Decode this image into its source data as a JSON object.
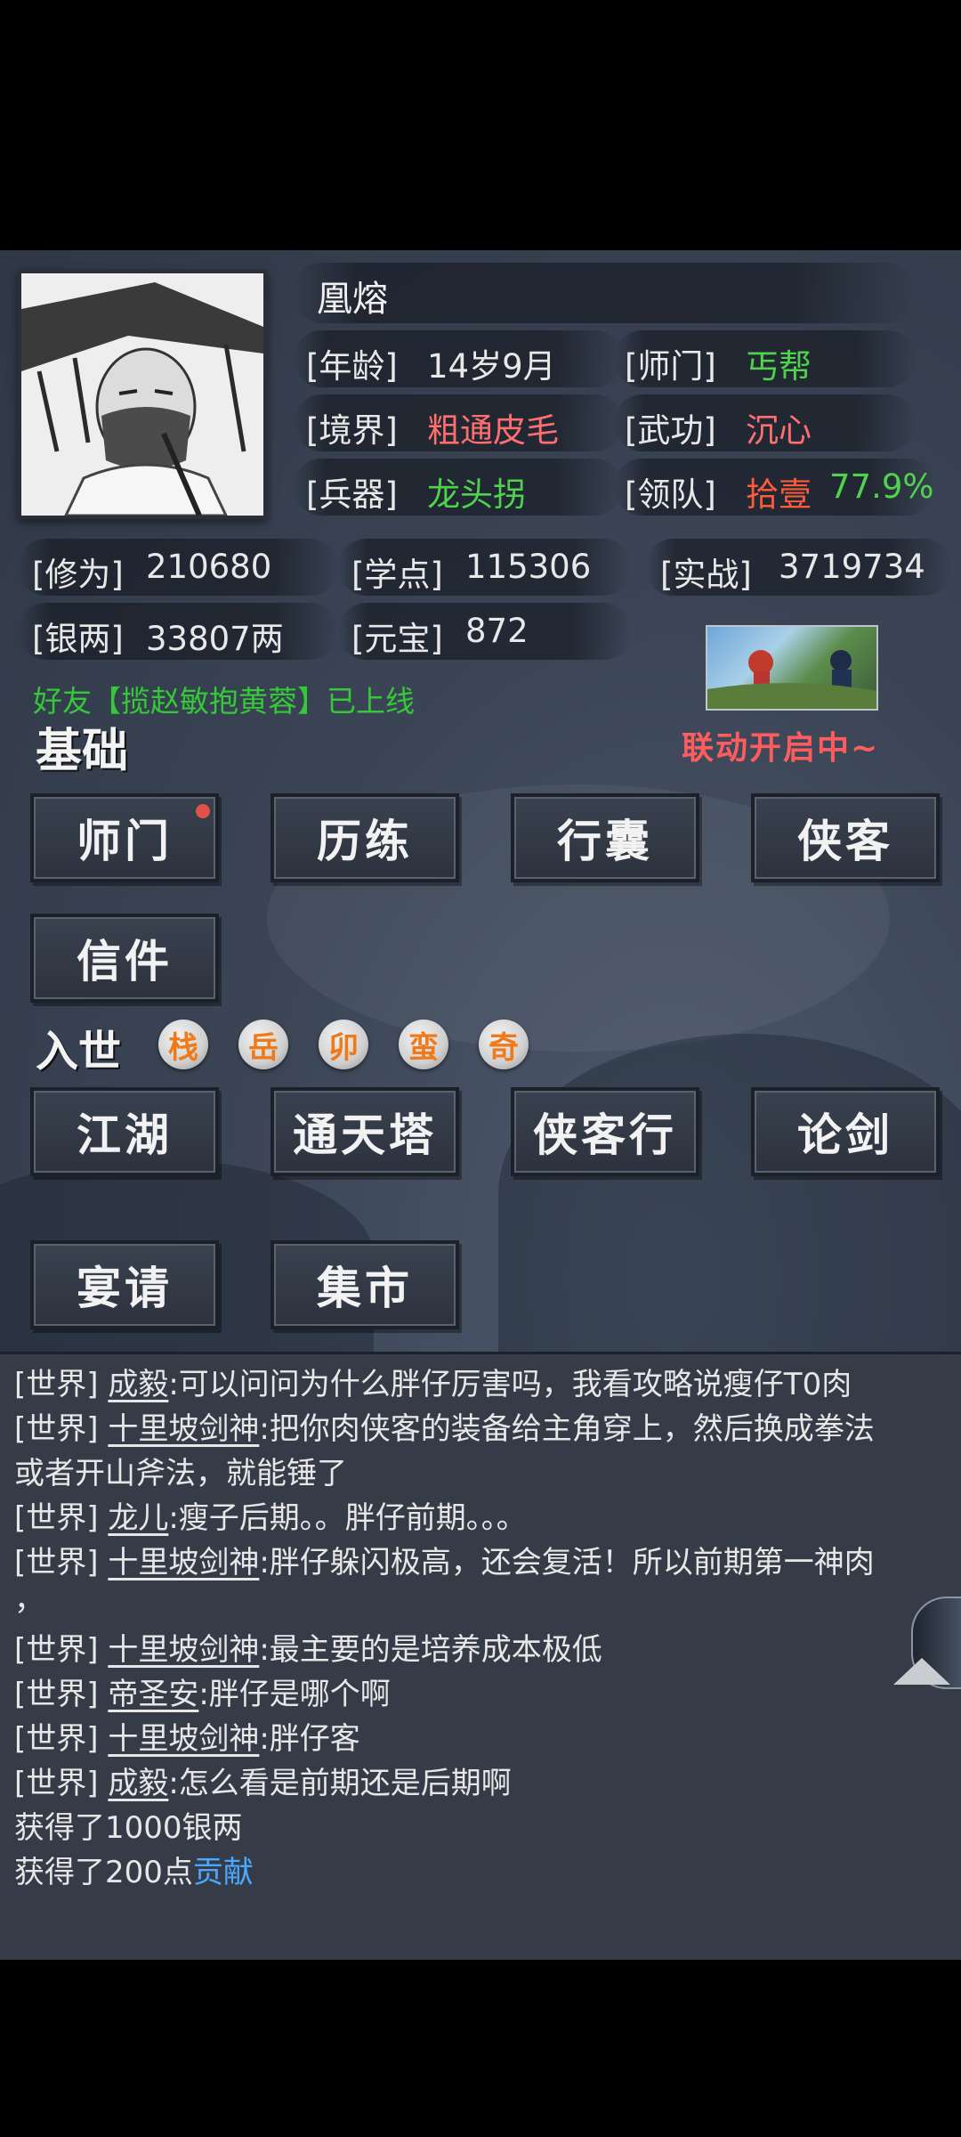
{
  "player": {
    "name": "凰熔",
    "age_label": "[年龄]",
    "age": "14岁9月",
    "sect_label": "[师门]",
    "sect": "丐帮",
    "realm_label": "[境界]",
    "realm": "粗通皮毛",
    "martial_label": "[武功]",
    "martial": "沉心",
    "weapon_label": "[兵器]",
    "weapon": "龙头拐",
    "team_label": "[领队]",
    "team": "拾壹",
    "team_pct": "77.9%"
  },
  "stats": {
    "cultivation_label": "[修为]",
    "cultivation": "210680",
    "study_label": "[学点]",
    "study": "115306",
    "combat_label": "[实战]",
    "combat": "3719734",
    "silver_label": "[银两]",
    "silver": "33807两",
    "yuanbao_label": "[元宝]",
    "yuanbao": "872"
  },
  "friend_notice": "好友【揽赵敏抱黄蓉】已上线",
  "event_text": "联动开启中~",
  "sections": {
    "basic": "基础",
    "world": "入世"
  },
  "basic_buttons": [
    "师门",
    "历练",
    "行囊",
    "侠客",
    "信件"
  ],
  "world_coins": [
    "栈",
    "岳",
    "卯",
    "蛮",
    "奇"
  ],
  "world_buttons": [
    "江湖",
    "通天塔",
    "侠客行",
    "论剑",
    "宴请",
    "集市"
  ],
  "chat": [
    {
      "tag": "[世界]",
      "user": "成毅",
      "msg": ":可以问问为什么胖仔厉害吗，我看攻略说瘦仔T0肉"
    },
    {
      "tag": "[世界]",
      "user": "十里坡剑神",
      "msg": ":把你肉侠客的装备给主角穿上，然后换成拳法"
    },
    {
      "cont": "或者开山斧法，就能锤了"
    },
    {
      "tag": "[世界]",
      "user": "龙儿",
      "msg": ":瘦子后期。。胖仔前期。。。"
    },
    {
      "tag": "[世界]",
      "user": "十里坡剑神",
      "msg": ":胖仔躲闪极高，还会复活！所以前期第一神肉"
    },
    {
      "cont": "，"
    },
    {
      "tag": "[世界]",
      "user": "十里坡剑神",
      "msg": ":最主要的是培养成本极低"
    },
    {
      "tag": "[世界]",
      "user": "帝圣安",
      "msg": ":胖仔是哪个啊"
    },
    {
      "tag": "[世界]",
      "user": "十里坡剑神",
      "msg": ":胖仔客"
    },
    {
      "tag": "[世界]",
      "user": "成毅",
      "msg": ":怎么看是前期还是后期啊"
    }
  ],
  "system": {
    "gain_silver": "获得了1000银两",
    "gain_contrib_prefix": "获得了200点",
    "gain_contrib_link": "贡献"
  }
}
